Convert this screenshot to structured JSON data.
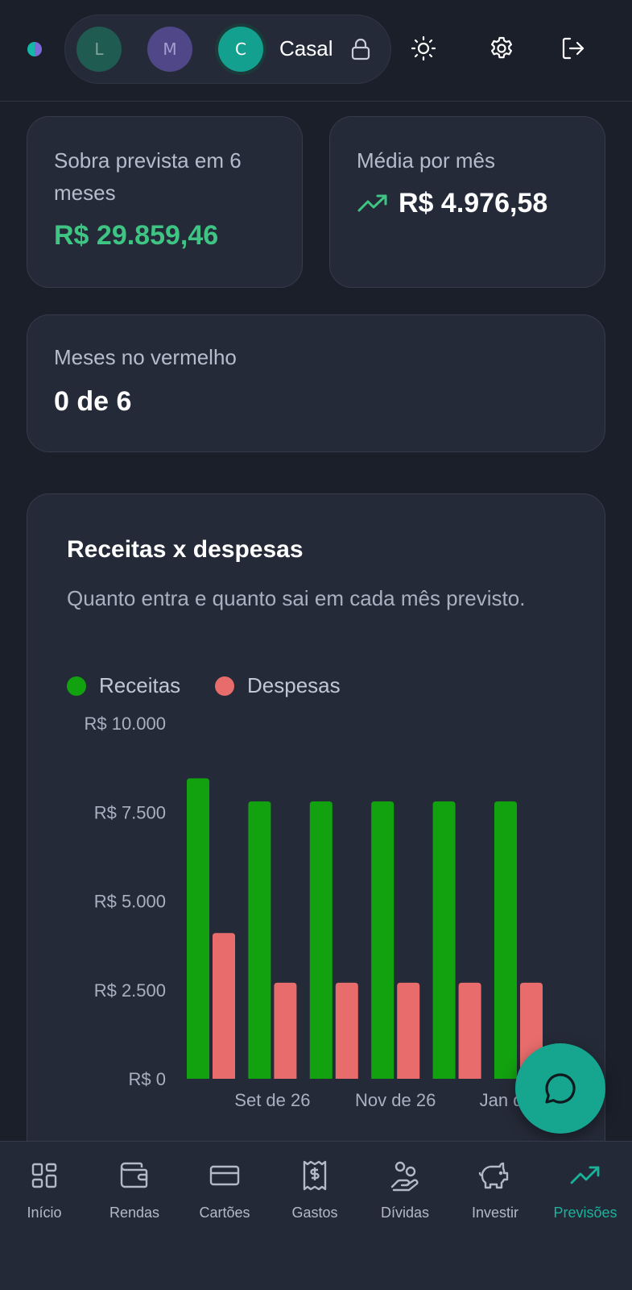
{
  "header": {
    "profiles": [
      {
        "initial": "L",
        "color": "#1f5b50"
      },
      {
        "initial": "M",
        "color": "#4f4788"
      },
      {
        "initial": "C",
        "color": "#14a08f"
      }
    ],
    "active_profile_name": "Casal"
  },
  "summary": {
    "surplus_label": "Sobra prevista em 6 meses",
    "surplus_value": "R$ 29.859,46",
    "average_label": "Média por mês",
    "average_value": "R$ 4.976,58",
    "red_months_label": "Meses no vermelho",
    "red_months_value": "0 de 6"
  },
  "chart": {
    "title": "Receitas x despesas",
    "subtitle": "Quanto entra e quanto sai em cada mês previsto.",
    "legend": [
      {
        "label": "Receitas",
        "color": "#12a10f"
      },
      {
        "label": "Despesas",
        "color": "#e86c6c"
      }
    ]
  },
  "chart_data": {
    "type": "bar",
    "categories": [
      "",
      "Set de 26",
      "",
      "Nov de 26",
      "",
      "Jan de 27"
    ],
    "series": [
      {
        "name": "Receitas",
        "values": [
          8450,
          7800,
          7800,
          7800,
          7800,
          7800
        ]
      },
      {
        "name": "Despesas",
        "values": [
          4100,
          2700,
          2700,
          2700,
          2700,
          2700
        ]
      }
    ],
    "yticks": [
      "R$ 0",
      "R$ 2.500",
      "R$ 5.000",
      "R$ 7.500",
      "R$ 10.000"
    ],
    "ylim": [
      0,
      10000
    ],
    "xlabels": [
      "Set de 26",
      "Nov de 26",
      "Jan de 27"
    ],
    "colors": [
      "#12a10f",
      "#e86c6c"
    ]
  },
  "nav": {
    "items": [
      {
        "label": "Início",
        "icon": "grid-icon"
      },
      {
        "label": "Rendas",
        "icon": "wallet-icon"
      },
      {
        "label": "Cartões",
        "icon": "card-icon"
      },
      {
        "label": "Gastos",
        "icon": "receipt-icon"
      },
      {
        "label": "Dívidas",
        "icon": "hand-coins-icon"
      },
      {
        "label": "Investir",
        "icon": "piggy-bank-icon"
      },
      {
        "label": "Previsões",
        "icon": "trending-up-icon"
      }
    ],
    "active_index": 6
  }
}
